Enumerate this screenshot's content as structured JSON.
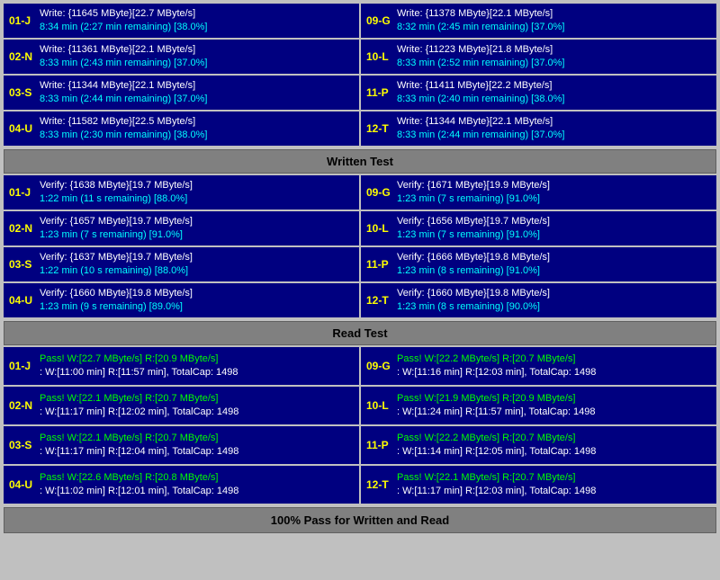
{
  "sections": {
    "write": {
      "cells": [
        {
          "id": "01-J",
          "line1": "Write: {11645 MByte}[22.7 MByte/s]",
          "line2": "8:34 min (2:27 min remaining)  [38.0%]"
        },
        {
          "id": "09-G",
          "line1": "Write: {11378 MByte}[22.1 MByte/s]",
          "line2": "8:32 min (2:45 min remaining)  [37.0%]"
        },
        {
          "id": "02-N",
          "line1": "Write: {11361 MByte}[22.1 MByte/s]",
          "line2": "8:33 min (2:43 min remaining)  [37.0%]"
        },
        {
          "id": "10-L",
          "line1": "Write: {11223 MByte}[21.8 MByte/s]",
          "line2": "8:33 min (2:52 min remaining)  [37.0%]"
        },
        {
          "id": "03-S",
          "line1": "Write: {11344 MByte}[22.1 MByte/s]",
          "line2": "8:33 min (2:44 min remaining)  [37.0%]"
        },
        {
          "id": "11-P",
          "line1": "Write: {11411 MByte}[22.2 MByte/s]",
          "line2": "8:33 min (2:40 min remaining)  [38.0%]"
        },
        {
          "id": "04-U",
          "line1": "Write: {11582 MByte}[22.5 MByte/s]",
          "line2": "8:33 min (2:30 min remaining)  [38.0%]"
        },
        {
          "id": "12-T",
          "line1": "Write: {11344 MByte}[22.1 MByte/s]",
          "line2": "8:33 min (2:44 min remaining)  [37.0%]"
        }
      ]
    },
    "written_test_label": "Written Test",
    "verify": {
      "cells": [
        {
          "id": "01-J",
          "line1": "Verify: {1638 MByte}[19.7 MByte/s]",
          "line2": "1:22 min (11 s remaining)  [88.0%]"
        },
        {
          "id": "09-G",
          "line1": "Verify: {1671 MByte}[19.9 MByte/s]",
          "line2": "1:23 min (7 s remaining)  [91.0%]"
        },
        {
          "id": "02-N",
          "line1": "Verify: {1657 MByte}[19.7 MByte/s]",
          "line2": "1:23 min (7 s remaining)  [91.0%]"
        },
        {
          "id": "10-L",
          "line1": "Verify: {1656 MByte}[19.7 MByte/s]",
          "line2": "1:23 min (7 s remaining)  [91.0%]"
        },
        {
          "id": "03-S",
          "line1": "Verify: {1637 MByte}[19.7 MByte/s]",
          "line2": "1:22 min (10 s remaining)  [88.0%]"
        },
        {
          "id": "11-P",
          "line1": "Verify: {1666 MByte}[19.8 MByte/s]",
          "line2": "1:23 min (8 s remaining)  [91.0%]"
        },
        {
          "id": "04-U",
          "line1": "Verify: {1660 MByte}[19.8 MByte/s]",
          "line2": "1:23 min (9 s remaining)  [89.0%]"
        },
        {
          "id": "12-T",
          "line1": "Verify: {1660 MByte}[19.8 MByte/s]",
          "line2": "1:23 min (8 s remaining)  [90.0%]"
        }
      ]
    },
    "read_test_label": "Read Test",
    "pass": {
      "cells": [
        {
          "id": "01-J",
          "line1": "Pass! W:[22.7 MByte/s] R:[20.9 MByte/s]",
          "line2": ": W:[11:00 min] R:[11:57 min], TotalCap: 1498"
        },
        {
          "id": "09-G",
          "line1": "Pass! W:[22.2 MByte/s] R:[20.7 MByte/s]",
          "line2": ": W:[11:16 min] R:[12:03 min], TotalCap: 1498"
        },
        {
          "id": "02-N",
          "line1": "Pass! W:[22.1 MByte/s] R:[20.7 MByte/s]",
          "line2": ": W:[11:17 min] R:[12:02 min], TotalCap: 1498"
        },
        {
          "id": "10-L",
          "line1": "Pass! W:[21.9 MByte/s] R:[20.9 MByte/s]",
          "line2": ": W:[11:24 min] R:[11:57 min], TotalCap: 1498"
        },
        {
          "id": "03-S",
          "line1": "Pass! W:[22.1 MByte/s] R:[20.7 MByte/s]",
          "line2": ": W:[11:17 min] R:[12:04 min], TotalCap: 1498"
        },
        {
          "id": "11-P",
          "line1": "Pass! W:[22.2 MByte/s] R:[20.7 MByte/s]",
          "line2": ": W:[11:14 min] R:[12:05 min], TotalCap: 1498"
        },
        {
          "id": "04-U",
          "line1": "Pass! W:[22.6 MByte/s] R:[20.8 MByte/s]",
          "line2": ": W:[11:02 min] R:[12:01 min], TotalCap: 1498"
        },
        {
          "id": "12-T",
          "line1": "Pass! W:[22.1 MByte/s] R:[20.7 MByte/s]",
          "line2": ": W:[11:17 min] R:[12:03 min], TotalCap: 1498"
        }
      ]
    },
    "footer_label": "100% Pass for Written and Read"
  }
}
